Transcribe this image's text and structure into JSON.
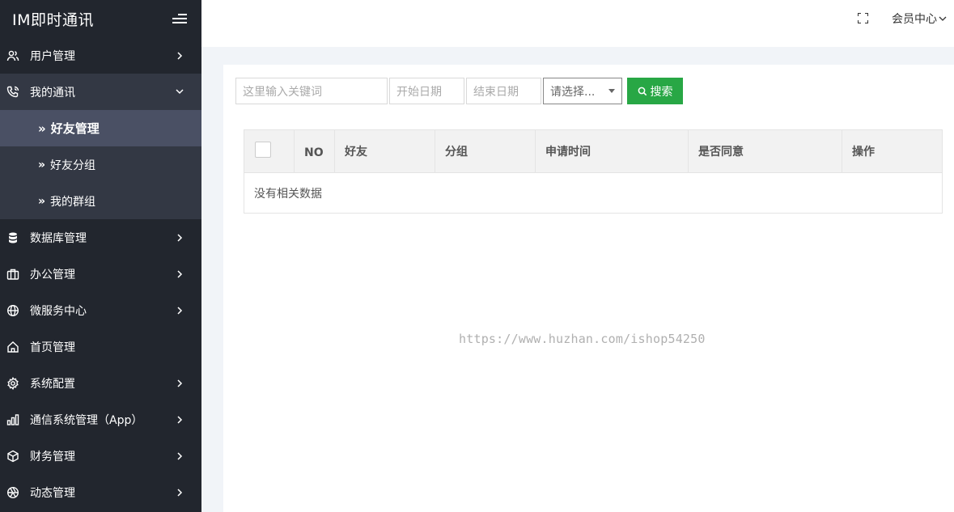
{
  "app": {
    "title": "IM即时通讯"
  },
  "sidebar": {
    "items": [
      {
        "label": "用户管理",
        "icon": "users-icon"
      },
      {
        "label": "我的通讯",
        "icon": "phone-icon"
      },
      {
        "label": "数据库管理",
        "icon": "database-icon"
      },
      {
        "label": "办公管理",
        "icon": "briefcase-icon"
      },
      {
        "label": "微服务中心",
        "icon": "globe-icon"
      },
      {
        "label": "首页管理",
        "icon": "home-icon"
      },
      {
        "label": "系统配置",
        "icon": "gear-icon"
      },
      {
        "label": "通信系统管理（App）",
        "icon": "bar-chart-icon"
      },
      {
        "label": "财务管理",
        "icon": "cube-icon"
      },
      {
        "label": "动态管理",
        "icon": "aperture-icon"
      }
    ],
    "sub_items": [
      {
        "label": "好友管理",
        "active": true
      },
      {
        "label": "好友分组",
        "active": false
      },
      {
        "label": "我的群组",
        "active": false
      }
    ],
    "sub_prefix": "»"
  },
  "header": {
    "member_center": "会员中心"
  },
  "toolbar": {
    "keyword_placeholder": "这里输入关键词",
    "start_date_placeholder": "开始日期",
    "end_date_placeholder": "结束日期",
    "select_value": "请选择...",
    "search_label": "搜索"
  },
  "table": {
    "columns": [
      "NO",
      "好友",
      "分组",
      "申请时间",
      "是否同意",
      "操作"
    ],
    "empty_text": "没有相关数据"
  },
  "watermark": "https://www.huzhan.com/ishop54250",
  "colors": {
    "sidebar_bg": "#22262e",
    "submenu_bg": "#333844",
    "active_bg": "#4a5064",
    "accent_green": "#28a745"
  }
}
